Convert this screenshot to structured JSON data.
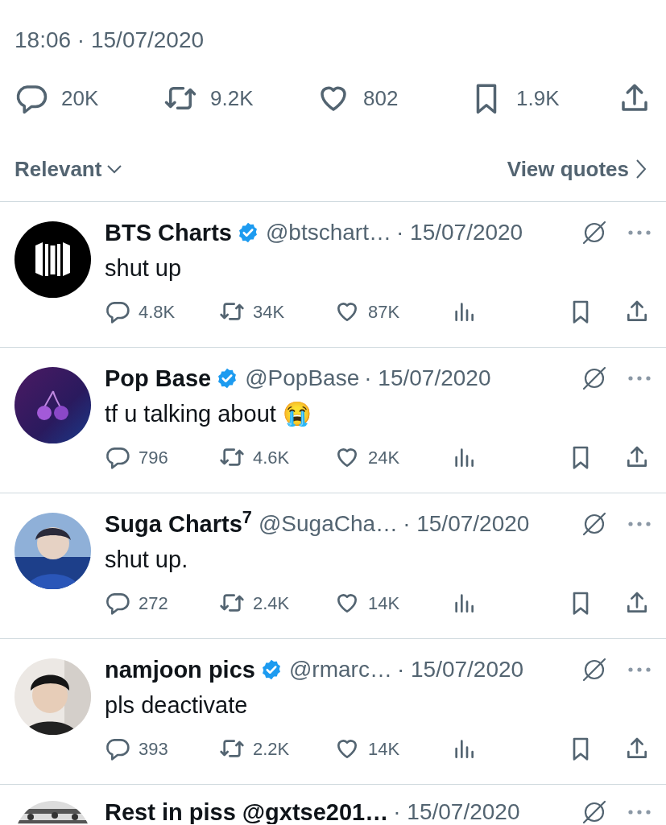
{
  "tweet": {
    "timestamp": "18:06 · 15/07/2020",
    "stats": [
      {
        "kind": "reply",
        "count": "20K"
      },
      {
        "kind": "retweet",
        "count": "9.2K"
      },
      {
        "kind": "like",
        "count": "802"
      },
      {
        "kind": "bookmark",
        "count": "1.9K"
      },
      {
        "kind": "share"
      }
    ]
  },
  "sort": {
    "label": "Relevant",
    "quotes_link": "View quotes"
  },
  "replies": [
    {
      "kind": "logo",
      "name": "BTS Charts",
      "verified": true,
      "handle": "@btschart…",
      "date": "· 15/07/2020",
      "text": "shut up",
      "counts": {
        "reply": "4.8K",
        "retweet": "34K",
        "like": "87K"
      }
    },
    {
      "kind": "cherries",
      "name": "Pop Base",
      "verified": true,
      "handle": "@PopBase",
      "date": "· 15/07/2020",
      "text": "tf u talking about 😭",
      "counts": {
        "reply": "796",
        "retweet": "4.6K",
        "like": "24K"
      }
    },
    {
      "kind": "picture",
      "name": "Suga Charts$^{7}$",
      "verified": false,
      "handle": "@SugaCha…",
      "date": "· 15/07/2020",
      "text": "shut up.",
      "counts": {
        "reply": "272",
        "retweet": "2.4K",
        "like": "14K"
      }
    },
    {
      "kind": "light-picture",
      "name": "namjoon pics",
      "verified": true,
      "handle": "@rmarc…",
      "date": "· 15/07/2020",
      "text": "pls deactivate",
      "counts": {
        "reply": "393",
        "retweet": "2.2K",
        "like": "14K"
      }
    },
    {
      "kind": "pattern",
      "name": "Rest in piss @gxtse201…",
      "verified": false,
      "date": "· 15/07/2020"
    }
  ]
}
